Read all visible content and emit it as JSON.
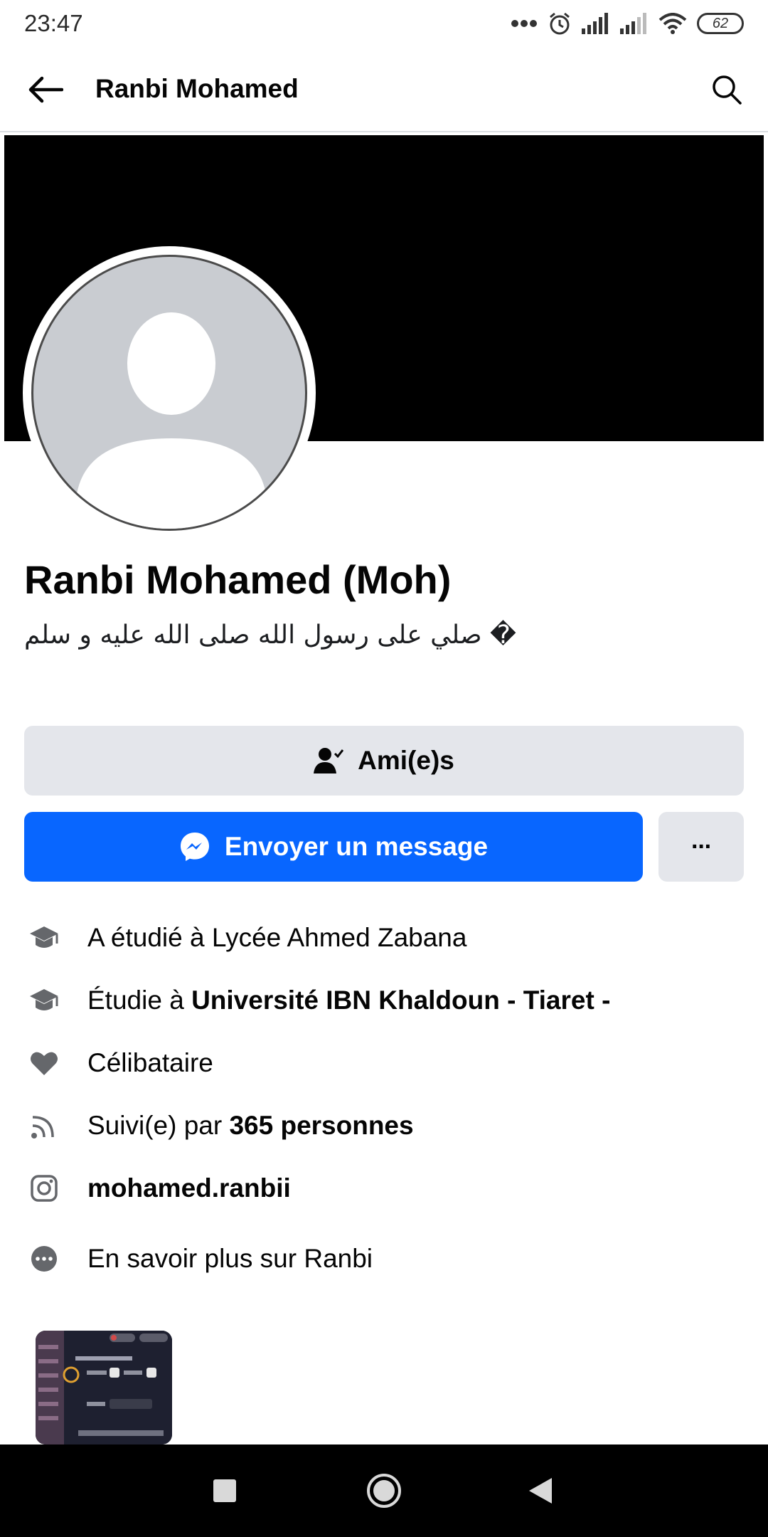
{
  "status_bar": {
    "time": "23:47",
    "battery": "62",
    "icons": [
      "more-dots-icon",
      "alarm-icon",
      "signal-icon",
      "signal-weak-icon",
      "wifi-icon",
      "battery-icon"
    ]
  },
  "app_bar": {
    "title": "Ranbi Mohamed"
  },
  "profile": {
    "name": "Ranbi Mohamed (Moh)",
    "bio": "صلي على رسول الله صلى الله عليه و سلم �"
  },
  "actions": {
    "friends_label": "Ami(e)s",
    "message_label": "Envoyer un message",
    "more_label": "···"
  },
  "intro": {
    "studied": {
      "prefix": "A étudié à Lycée Ahmed Zabana",
      "bold": ""
    },
    "studies": {
      "prefix": "Étudie à ",
      "bold": "Université IBN Khaldoun - Tiaret -"
    },
    "relationship": {
      "prefix": "Célibataire",
      "bold": ""
    },
    "followers": {
      "prefix": "Suivi(e) par ",
      "bold": "365 personnes"
    },
    "instagram": {
      "prefix": "",
      "bold": "mohamed.ranbii"
    },
    "about": {
      "prefix": "En savoir plus sur Ranbi",
      "bold": ""
    }
  },
  "colors": {
    "accent": "#0866ff",
    "button_gray": "#e4e6eb",
    "cover": "#000000",
    "avatar_bg": "#c9ccd1"
  }
}
